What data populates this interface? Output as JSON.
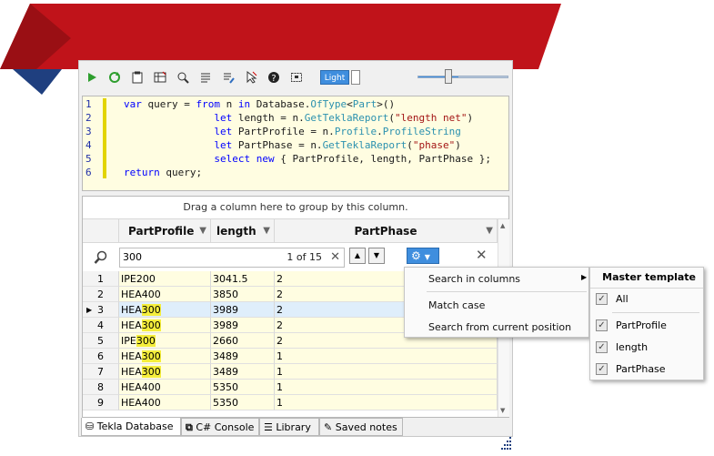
{
  "toolbar": {
    "light_label": "Light",
    "zoom_level": 0.45
  },
  "editor": {
    "line_numbers": [
      "1",
      "2",
      "3",
      "4",
      "5",
      "6"
    ]
  },
  "grid": {
    "group_hint": "Drag a column here to group by this column.",
    "columns": [
      "PartProfile",
      "length",
      "PartPhase"
    ],
    "search_value": "300",
    "search_count": "1 of 15",
    "rows": [
      {
        "idx": "1",
        "profile_a": "IPE200",
        "profile_hl": "",
        "length": "3041.5",
        "phase": "2"
      },
      {
        "idx": "2",
        "profile_a": "HEA400",
        "profile_hl": "",
        "length": "3850",
        "phase": "2"
      },
      {
        "idx": "3",
        "profile_a": "HEA",
        "profile_hl": "300",
        "length": "3989",
        "phase": "2"
      },
      {
        "idx": "4",
        "profile_a": "HEA",
        "profile_hl": "300",
        "length": "3989",
        "phase": "2"
      },
      {
        "idx": "5",
        "profile_a": "IPE",
        "profile_hl": "300",
        "length": "2660",
        "phase": "2"
      },
      {
        "idx": "6",
        "profile_a": "HEA",
        "profile_hl": "300",
        "length": "3489",
        "phase": "1"
      },
      {
        "idx": "7",
        "profile_a": "HEA",
        "profile_hl": "300",
        "length": "3489",
        "phase": "1"
      },
      {
        "idx": "8",
        "profile_a": "HEA400",
        "profile_hl": "",
        "length": "5350",
        "phase": "1"
      },
      {
        "idx": "9",
        "profile_a": "HEA400",
        "profile_hl": "",
        "length": "5350",
        "phase": "1"
      }
    ]
  },
  "tabs": [
    "Tekla Database",
    "C# Console",
    "Library",
    "Saved notes"
  ],
  "search_menu": {
    "items": [
      "Search in columns",
      "Match case",
      "Search from current position"
    ]
  },
  "column_submenu": {
    "title": "Master template",
    "options": [
      "All",
      "PartProfile",
      "length",
      "PartPhase"
    ]
  },
  "colors": {
    "banner_red": "#c0131a",
    "banner_navy": "#1f3f7f",
    "accent_blue": "#3f8ede",
    "editor_bg": "#fffde1",
    "search_highlight": "#f5ee3c"
  }
}
